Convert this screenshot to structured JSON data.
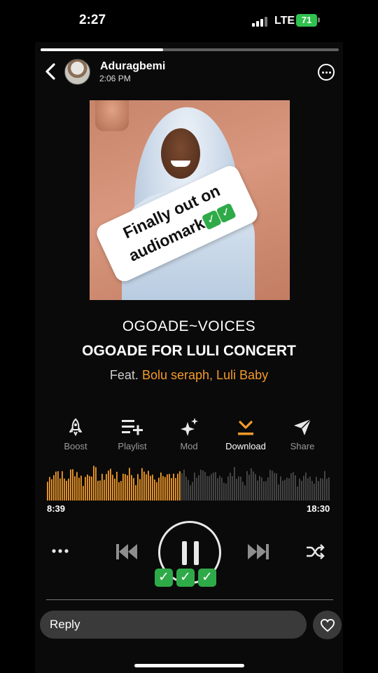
{
  "status_bar": {
    "time": "2:27",
    "network": "LTE",
    "battery": "71"
  },
  "story": {
    "progress": 0.41,
    "username": "Aduragbemi",
    "post_time": "2:06 PM"
  },
  "cover_art": {
    "sticker_line1": "Finally out on",
    "sticker_line2": "audiomark",
    "sticker_checks": [
      "✓",
      "✓"
    ]
  },
  "track": {
    "artist": "OGOADE~VOICES",
    "title": "OGOADE FOR LULI  CONCERT",
    "feat_prefix": "Feat. ",
    "featured_artists": [
      "Bolu seraph",
      "Luli Baby"
    ],
    "feat_separator": ", "
  },
  "actions": [
    {
      "label": "Boost",
      "icon": "rocket-icon",
      "active": false
    },
    {
      "label": "Playlist",
      "icon": "playlist-add-icon",
      "active": false
    },
    {
      "label": "Mod",
      "icon": "sparkles-icon",
      "active": false
    },
    {
      "label": "Download",
      "icon": "download-icon",
      "active": true
    },
    {
      "label": "Share",
      "icon": "send-icon",
      "active": false
    }
  ],
  "player": {
    "elapsed": "8:39",
    "duration": "18:30",
    "played_fraction": 0.467,
    "state": "playing",
    "emoji_checks": [
      "✓",
      "✓",
      "✓"
    ]
  },
  "reply": {
    "placeholder": "Reply"
  },
  "colors": {
    "accent": "#f39a2a",
    "waveform_unplayed": "#4a4a4a",
    "battery": "#30c24f",
    "check": "#2faa48"
  }
}
